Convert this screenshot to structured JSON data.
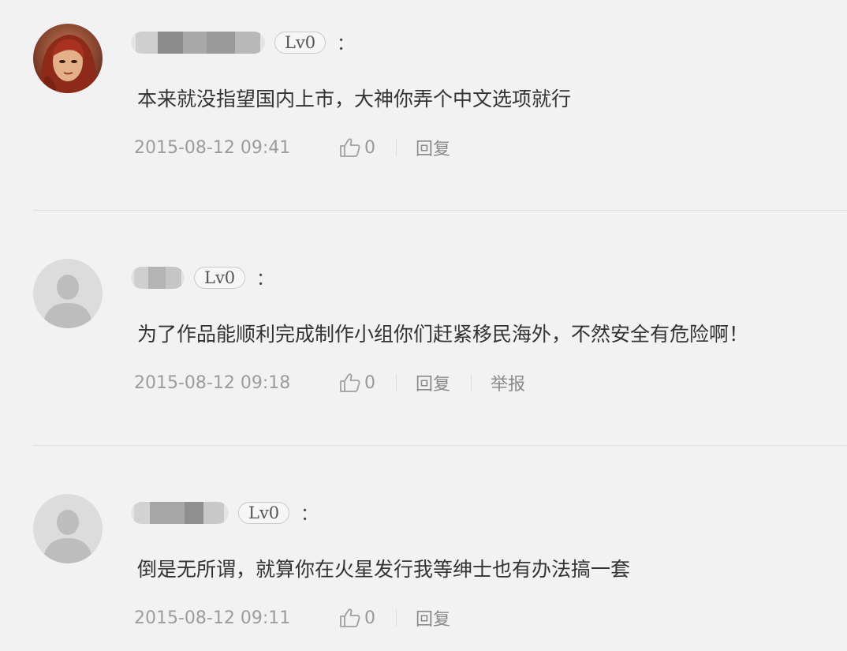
{
  "comments": [
    {
      "level": "Lv0",
      "colon": "：",
      "text": "本来就没指望国内上市，大神你弄个中文选项就行",
      "time": "2015-08-12 09:41",
      "likes": "0",
      "reply": "回复"
    },
    {
      "level": "Lv0",
      "colon": "：",
      "text": "为了作品能顺利完成制作小组你们赶紧移民海外，不然安全有危险啊！",
      "time": "2015-08-12 09:18",
      "likes": "0",
      "reply": "回复",
      "report": "举报"
    },
    {
      "level": "Lv0",
      "colon": "：",
      "text": "倒是无所谓，就算你在火星发行我等绅士也有办法搞一套",
      "time": "2015-08-12 09:11",
      "likes": "0",
      "reply": "回复"
    }
  ],
  "colors": {
    "background": "#f2f2f2",
    "text": "#333333",
    "meta": "#9c9c9c",
    "divider": "#dedede"
  }
}
